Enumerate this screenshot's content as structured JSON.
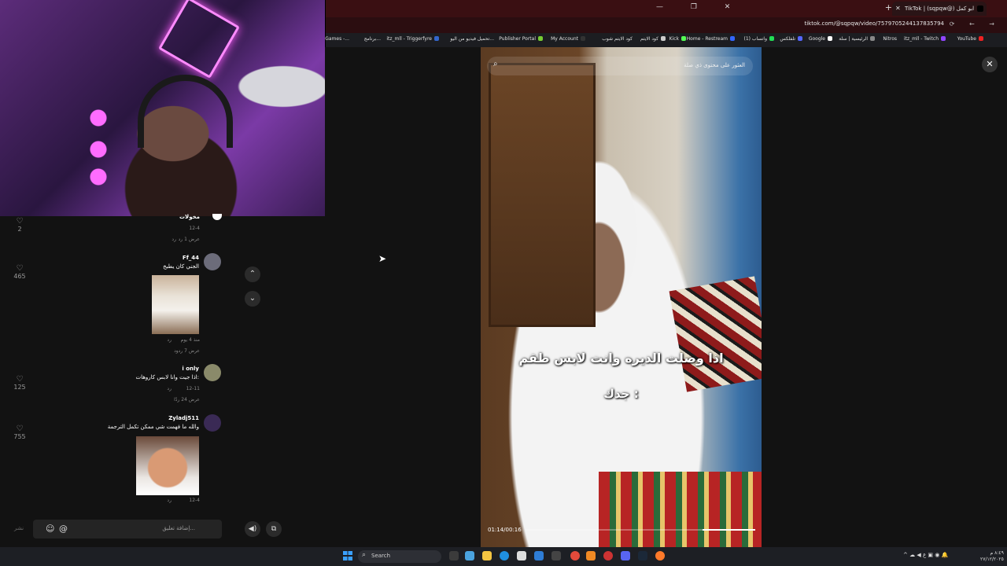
{
  "browser": {
    "tab_title": "TikTok | (sqpqw@) ابو كمل",
    "url": "tiktok.com/@sqpqw/video/7579705244137835794",
    "bookmarks": [
      "YouTube",
      "itz_mll - Twitch",
      "Nitros",
      "الرئيسية | سلة",
      "Google",
      "تلفلكس",
      "(1) واتساب",
      "Home - Restream",
      "Kick",
      "كود الايتم",
      "كود الايتم شوب",
      "My Account",
      "Publisher Portal",
      "تحميل فيديو من اليو...",
      "itz_mll - Triggerfyre",
      "برنامج...",
      "Epic Games -..."
    ]
  },
  "video": {
    "search_placeholder": "العثور على محتوى ذي صلة",
    "caption_line1": "اذا وصلت الديره وانت لابس طقم",
    "caption_line2": "جدك :",
    "time": "01:14/00:16",
    "progress": 0.23
  },
  "comments": {
    "top_partial": {
      "name": "مخولات",
      "date": "12-4",
      "reply": "رد",
      "view_replies": "عرض 1 رد",
      "likes": "2"
    },
    "items": [
      {
        "name": "Ff_44",
        "text": "الجني كان يطبخ",
        "date": "منذ 4 يوم",
        "reply": "رد",
        "view_replies": "عرض 7 ردود",
        "likes": "465"
      },
      {
        "name": "i only",
        "text": "اذا جيت وانا لابس كاروهات:",
        "date": "12-11",
        "reply": "رد",
        "view_replies": "عرض 24 ردًا",
        "likes": "125"
      },
      {
        "name": "Zyladj511",
        "text": "والله ما فهمت شي ممكن تكمل الترجمة",
        "date": "12-4",
        "reply": "رد",
        "likes": "755"
      }
    ],
    "input_placeholder": "إضافة تعليق...",
    "post_label": "نشر"
  },
  "taskbar": {
    "search_label": "Search",
    "time": "٨:٤٩ م",
    "date": "٢٧/١٢/٢٠٢٥",
    "lang": "ع"
  },
  "icons": {
    "close": "✕",
    "search": "🔍",
    "up": "⌃",
    "down": "⌄",
    "heart": "♡",
    "emoji": "☺",
    "mention": "@",
    "volume": "🔊"
  },
  "colors": {
    "tab_bar": "#3a0f12",
    "page_bg": "#121212",
    "accent": "#ff6cff"
  }
}
